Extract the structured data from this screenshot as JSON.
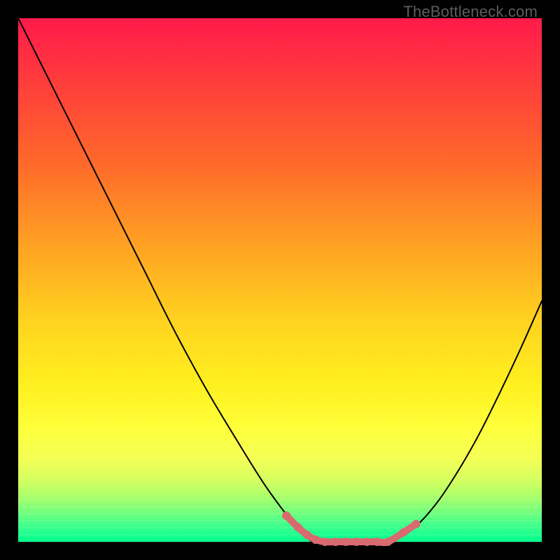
{
  "watermark": "TheBottleneck.com",
  "chart_data": {
    "type": "line",
    "title": "",
    "xlabel": "",
    "ylabel": "",
    "xlim": [
      0,
      1
    ],
    "ylim": [
      0,
      1
    ],
    "grid": false,
    "series": [
      {
        "name": "left-curve",
        "color": "#000000",
        "x": [
          0.0,
          0.06,
          0.12,
          0.18,
          0.24,
          0.3,
          0.36,
          0.42,
          0.47,
          0.51,
          0.54,
          0.56
        ],
        "y": [
          1.0,
          0.88,
          0.76,
          0.64,
          0.52,
          0.4,
          0.29,
          0.19,
          0.11,
          0.055,
          0.02,
          0.0
        ]
      },
      {
        "name": "flat-bottom",
        "color": "#000000",
        "x": [
          0.56,
          0.6,
          0.64,
          0.68,
          0.72
        ],
        "y": [
          0.0,
          0.0,
          0.0,
          0.0,
          0.002
        ]
      },
      {
        "name": "right-curve",
        "color": "#000000",
        "x": [
          0.72,
          0.76,
          0.8,
          0.84,
          0.88,
          0.92,
          0.96,
          1.0
        ],
        "y": [
          0.002,
          0.03,
          0.075,
          0.135,
          0.205,
          0.285,
          0.37,
          0.46
        ]
      }
    ],
    "markers": {
      "name": "bottom-dots",
      "color": "#d96a6f",
      "radius": 6,
      "points": [
        {
          "x": 0.512,
          "y": 0.05
        },
        {
          "x": 0.534,
          "y": 0.028
        },
        {
          "x": 0.552,
          "y": 0.013
        },
        {
          "x": 0.568,
          "y": 0.004
        },
        {
          "x": 0.586,
          "y": 0.0
        },
        {
          "x": 0.606,
          "y": 0.0
        },
        {
          "x": 0.626,
          "y": 0.0
        },
        {
          "x": 0.646,
          "y": 0.0
        },
        {
          "x": 0.666,
          "y": 0.0
        },
        {
          "x": 0.686,
          "y": 0.0
        },
        {
          "x": 0.706,
          "y": 0.0
        },
        {
          "x": 0.736,
          "y": 0.018
        },
        {
          "x": 0.76,
          "y": 0.034
        }
      ]
    },
    "green_bands": {
      "color_top_fraction": 0.92,
      "lines": 7
    }
  }
}
